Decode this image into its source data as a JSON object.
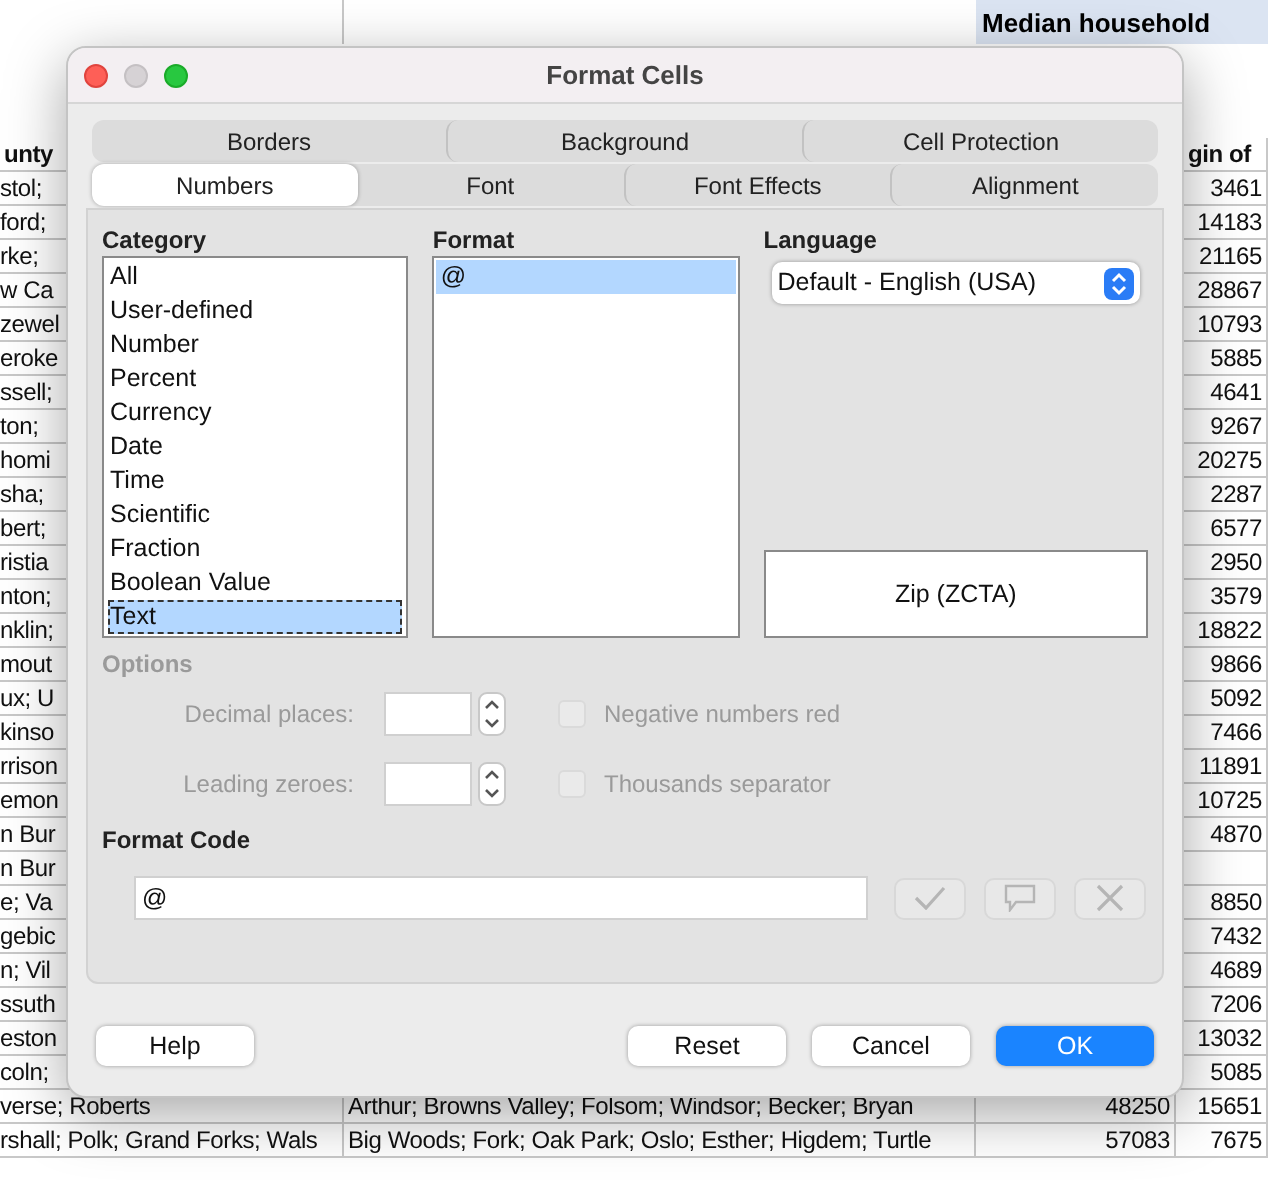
{
  "sheet": {
    "header": "Median household",
    "column_1_header": "unty",
    "column_4_header": "gin of",
    "rows": [
      {
        "column_1": "stol;",
        "column_4": "3461"
      },
      {
        "column_1": "ford;",
        "column_4": "14183"
      },
      {
        "column_1": "rke;",
        "column_4": "21165"
      },
      {
        "column_1": "w Ca",
        "column_4": "28867"
      },
      {
        "column_1": "zewel",
        "column_4": "10793"
      },
      {
        "column_1": "eroke",
        "column_4": "5885"
      },
      {
        "column_1": "ssell;",
        "column_4": "4641"
      },
      {
        "column_1": "ton;",
        "column_4": "9267"
      },
      {
        "column_1": "homi",
        "column_4": "20275"
      },
      {
        "column_1": "sha;",
        "column_4": "2287"
      },
      {
        "column_1": "bert;",
        "column_4": "6577"
      },
      {
        "column_1": "ristia",
        "column_4": "2950"
      },
      {
        "column_1": "nton;",
        "column_4": "3579"
      },
      {
        "column_1": "nklin;",
        "column_4": "18822"
      },
      {
        "column_1": "mout",
        "column_4": "9866"
      },
      {
        "column_1": "ux; U",
        "column_4": "5092"
      },
      {
        "column_1": "kinso",
        "column_4": "7466"
      },
      {
        "column_1": "rrison",
        "column_4": "11891"
      },
      {
        "column_1": "emon",
        "column_4": "10725"
      },
      {
        "column_1": "n Bur",
        "column_4": "4870"
      },
      {
        "column_1": "n Bur"
      },
      {
        "column_1": "e; Va",
        "column_4": "8850"
      },
      {
        "column_1": "gebic",
        "column_4": "7432"
      },
      {
        "column_1": "n; Vil",
        "column_4": "4689"
      },
      {
        "column_1": "ssuth",
        "column_4": "7206"
      },
      {
        "column_1": "eston",
        "column_4": "13032"
      },
      {
        "column_1": "coln;",
        "column_4": "5085"
      },
      {
        "column_1": "verse; Roberts",
        "column_2": "Arthur; Browns Valley; Folsom; Windsor; Becker; Bryan",
        "column_3": "48250",
        "column_4": "15651"
      },
      {
        "column_1": "rshall; Polk; Grand Forks; Wals",
        "column_2": "Big Woods; Fork; Oak Park; Oslo; Esther; Higdem; Turtle",
        "column_3": "57083",
        "column_4": "7675"
      }
    ]
  },
  "dialog": {
    "title": "Format Cells",
    "tab_rows": [
      [
        {
          "label": "Borders",
          "selected": false
        },
        {
          "label": "Background",
          "selected": false
        },
        {
          "label": "Cell Protection",
          "selected": false
        }
      ],
      [
        {
          "label": "Numbers",
          "selected": true
        },
        {
          "label": "Font",
          "selected": false
        },
        {
          "label": "Font Effects",
          "selected": false
        },
        {
          "label": "Alignment",
          "selected": false
        }
      ]
    ],
    "category": {
      "label": "Category",
      "items": [
        {
          "label": "All",
          "selected": false
        },
        {
          "label": "User-defined",
          "selected": false
        },
        {
          "label": "Number",
          "selected": false
        },
        {
          "label": "Percent",
          "selected": false
        },
        {
          "label": "Currency",
          "selected": false
        },
        {
          "label": "Date",
          "selected": false
        },
        {
          "label": "Time",
          "selected": false
        },
        {
          "label": "Scientific",
          "selected": false
        },
        {
          "label": "Fraction",
          "selected": false
        },
        {
          "label": "Boolean Value",
          "selected": false
        },
        {
          "label": "Text",
          "selected": true
        }
      ]
    },
    "format": {
      "label": "Format",
      "items": [
        {
          "label": "@",
          "selected": true
        }
      ]
    },
    "language": {
      "label": "Language",
      "value": "Default - English (USA)"
    },
    "preview": "Zip (ZCTA)",
    "options": {
      "label": "Options",
      "disabled": true,
      "spinners": [
        {
          "label": "Decimal places:"
        },
        {
          "label": "Leading zeroes:"
        }
      ],
      "checkboxes": [
        {
          "label": "Negative numbers red",
          "checked": false
        },
        {
          "label": "Thousands separator",
          "checked": false
        }
      ]
    },
    "format_code": {
      "label": "Format Code",
      "value": "@"
    },
    "buttons": [
      {
        "label": "Help",
        "kind": "plain"
      },
      {
        "label": "Reset",
        "kind": "plain"
      },
      {
        "label": "Cancel",
        "kind": "plain"
      },
      {
        "label": "OK",
        "kind": "default"
      }
    ]
  }
}
